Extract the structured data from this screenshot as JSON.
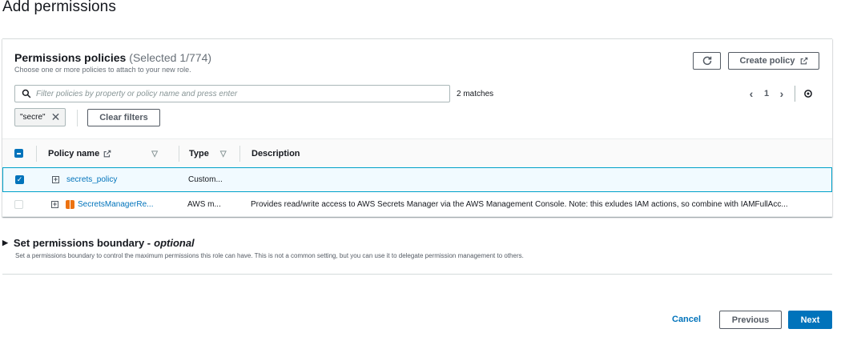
{
  "page_title": "Add permissions",
  "policies_panel": {
    "title": "Permissions policies",
    "selected_count": "(Selected 1/774)",
    "description": "Choose one or more policies to attach to your new role.",
    "refresh_icon": "refresh-icon",
    "create_policy_label": "Create policy",
    "search": {
      "placeholder": "Filter policies by property or policy name and press enter",
      "value": ""
    },
    "matches": "2 matches",
    "pagination": {
      "current_page": "1"
    },
    "filter_token": "\"secre\"",
    "clear_filters_label": "Clear filters",
    "columns": {
      "policy_name": "Policy name",
      "type": "Type",
      "description": "Description"
    },
    "rows": [
      {
        "selected": true,
        "name": "secrets_policy",
        "type": "Custom...",
        "description": "",
        "aws_managed": false
      },
      {
        "selected": false,
        "name": "SecretsManagerRe...",
        "type": "AWS m...",
        "description": "Provides read/write access to AWS Secrets Manager via the AWS Management Console. Note: this exludes IAM actions, so combine with IAMFullAcc...",
        "aws_managed": true
      }
    ]
  },
  "boundary": {
    "title": "Set permissions boundary -",
    "optional": "optional",
    "description": "Set a permissions boundary to control the maximum permissions this role can have. This is not a common setting, but you can use it to delegate permission management to others."
  },
  "footer": {
    "cancel_label": "Cancel",
    "previous_label": "Previous",
    "next_label": "Next"
  },
  "colors": {
    "primary": "#0073bb",
    "selected_row_bg": "#f1faff",
    "selected_row_border": "#00a1c9",
    "aws_icon": "#ec7211"
  }
}
